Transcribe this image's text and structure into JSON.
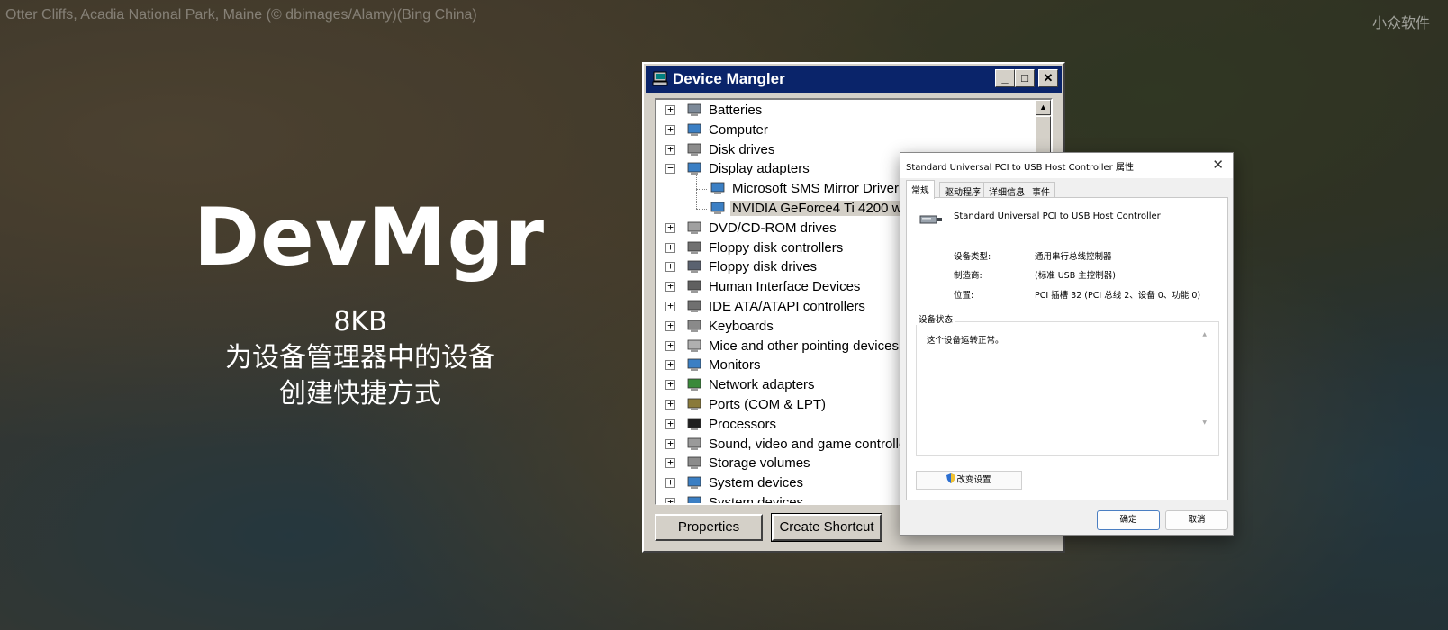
{
  "wallpaper": {
    "credit": "Otter Cliffs, Acadia National Park, Maine (© dbimages/Alamy)(Bing China)"
  },
  "brand": "小众软件",
  "hero": {
    "title": "DevMgr",
    "size": "8KB",
    "tagline_1": "为设备管理器中的设备",
    "tagline_2": "创建快捷方式"
  },
  "device_window": {
    "title": "Device Mangler",
    "controls": {
      "minimize": "_",
      "maximize": "□",
      "close": "✕"
    },
    "tree": [
      {
        "label": "Batteries",
        "icon": "battery-icon",
        "expander": "+"
      },
      {
        "label": "Computer",
        "icon": "computer-icon",
        "expander": "+"
      },
      {
        "label": "Disk drives",
        "icon": "disk-drive-icon",
        "expander": "+"
      },
      {
        "label": "Display adapters",
        "icon": "display-adapter-icon",
        "expander": "−"
      },
      {
        "label": "Microsoft SMS Mirror Driver",
        "icon": "monitor-icon",
        "child": true
      },
      {
        "label": "NVIDIA GeForce4 Ti 4200 w",
        "icon": "monitor-icon",
        "child": true,
        "selected": true
      },
      {
        "label": "DVD/CD-ROM drives",
        "icon": "cdrom-icon",
        "expander": "+"
      },
      {
        "label": "Floppy disk controllers",
        "icon": "floppy-controller-icon",
        "expander": "+"
      },
      {
        "label": "Floppy disk drives",
        "icon": "floppy-drive-icon",
        "expander": "+"
      },
      {
        "label": "Human Interface Devices",
        "icon": "hid-icon",
        "expander": "+"
      },
      {
        "label": "IDE ATA/ATAPI controllers",
        "icon": "ide-icon",
        "expander": "+"
      },
      {
        "label": "Keyboards",
        "icon": "keyboard-icon",
        "expander": "+"
      },
      {
        "label": "Mice and other pointing devices",
        "icon": "mouse-icon",
        "expander": "+"
      },
      {
        "label": "Monitors",
        "icon": "monitor-icon",
        "expander": "+"
      },
      {
        "label": "Network adapters",
        "icon": "network-adapter-icon",
        "expander": "+"
      },
      {
        "label": "Ports (COM & LPT)",
        "icon": "port-icon",
        "expander": "+"
      },
      {
        "label": "Processors",
        "icon": "processor-icon",
        "expander": "+"
      },
      {
        "label": "Sound, video and game controlle",
        "icon": "sound-icon",
        "expander": "+"
      },
      {
        "label": "Storage volumes",
        "icon": "storage-icon",
        "expander": "+"
      },
      {
        "label": "System devices",
        "icon": "system-device-icon",
        "expander": "+"
      },
      {
        "label": "System devices",
        "icon": "system-device-icon",
        "expander": "+"
      }
    ],
    "buttons": {
      "properties": "Properties",
      "create_shortcut": "Create Shortcut"
    }
  },
  "properties_dialog": {
    "title": "Standard Universal PCI to USB Host Controller 属性",
    "close": "✕",
    "tabs": [
      "常规",
      "驱动程序",
      "详细信息",
      "事件"
    ],
    "device_name": "Standard Universal PCI to USB Host Controller",
    "fields": [
      {
        "key": "设备类型:",
        "value": "通用串行总线控制器"
      },
      {
        "key": "制造商:",
        "value": "(标准 USB 主控制器)"
      },
      {
        "key": "位置:",
        "value": "PCI 插槽 32 (PCI 总线 2、设备 0、功能 0)"
      }
    ],
    "status_group": "设备状态",
    "status_text": "这个设备运转正常。",
    "change_settings": "改变设置",
    "ok": "确定",
    "cancel": "取消"
  },
  "colors": {
    "win_title": "#0a246a",
    "win_face": "#d4d0c8",
    "accent_blue": "#4a7ec2"
  }
}
